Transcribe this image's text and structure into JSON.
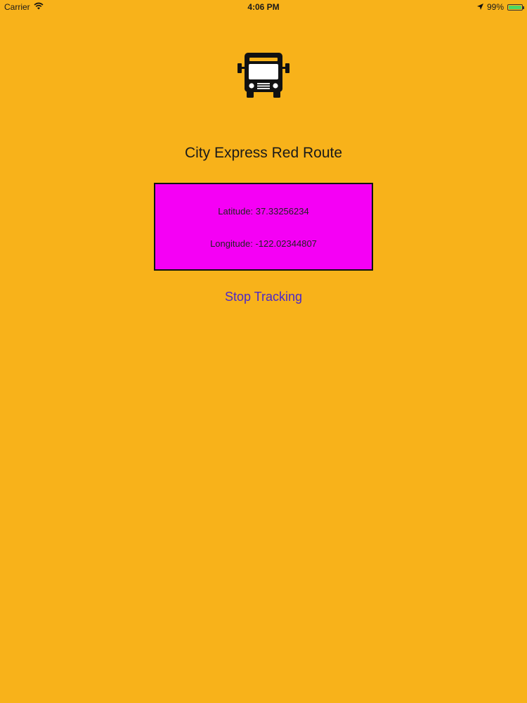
{
  "status_bar": {
    "carrier": "Carrier",
    "time": "4:06 PM",
    "battery_percent": "99%",
    "battery_level": 0.99,
    "icons": [
      "wifi-icon",
      "location-arrow-icon",
      "battery-icon"
    ]
  },
  "header": {
    "icon": "bus-icon",
    "title": "City Express Red Route"
  },
  "coordinates": {
    "latitude_label": "Latitude:",
    "latitude_value": "37.33256234",
    "longitude_label": "Longitude:",
    "longitude_value": "-122.02344807"
  },
  "actions": {
    "stop_tracking_label": "Stop Tracking"
  },
  "colors": {
    "background": "#F8B21A",
    "panel": "#F500F5",
    "link": "#4A28C9"
  }
}
